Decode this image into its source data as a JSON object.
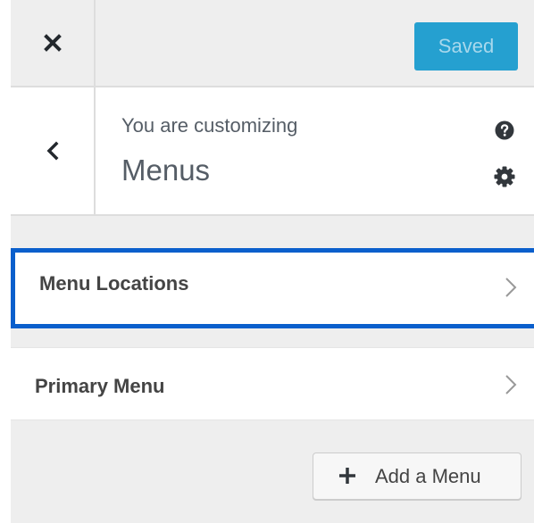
{
  "header": {
    "close_icon": "close-icon",
    "saved_label": "Saved"
  },
  "info": {
    "back_icon": "chevron-left-icon",
    "customizing_label": "You are customizing",
    "panel_title": "Menus",
    "help_icon": "help-icon",
    "settings_icon": "gear-icon"
  },
  "sections": [
    {
      "label": "Menu Locations",
      "focused": true,
      "icon": "chevron-right-icon"
    },
    {
      "label": "Primary Menu",
      "focused": false,
      "icon": "chevron-right-icon"
    }
  ],
  "add_menu": {
    "icon": "plus-icon",
    "label": "Add a Menu"
  },
  "colors": {
    "panel_background": "#eeeeee",
    "saved_button": "#25a0d0",
    "focus_border": "#0a5fcc"
  }
}
